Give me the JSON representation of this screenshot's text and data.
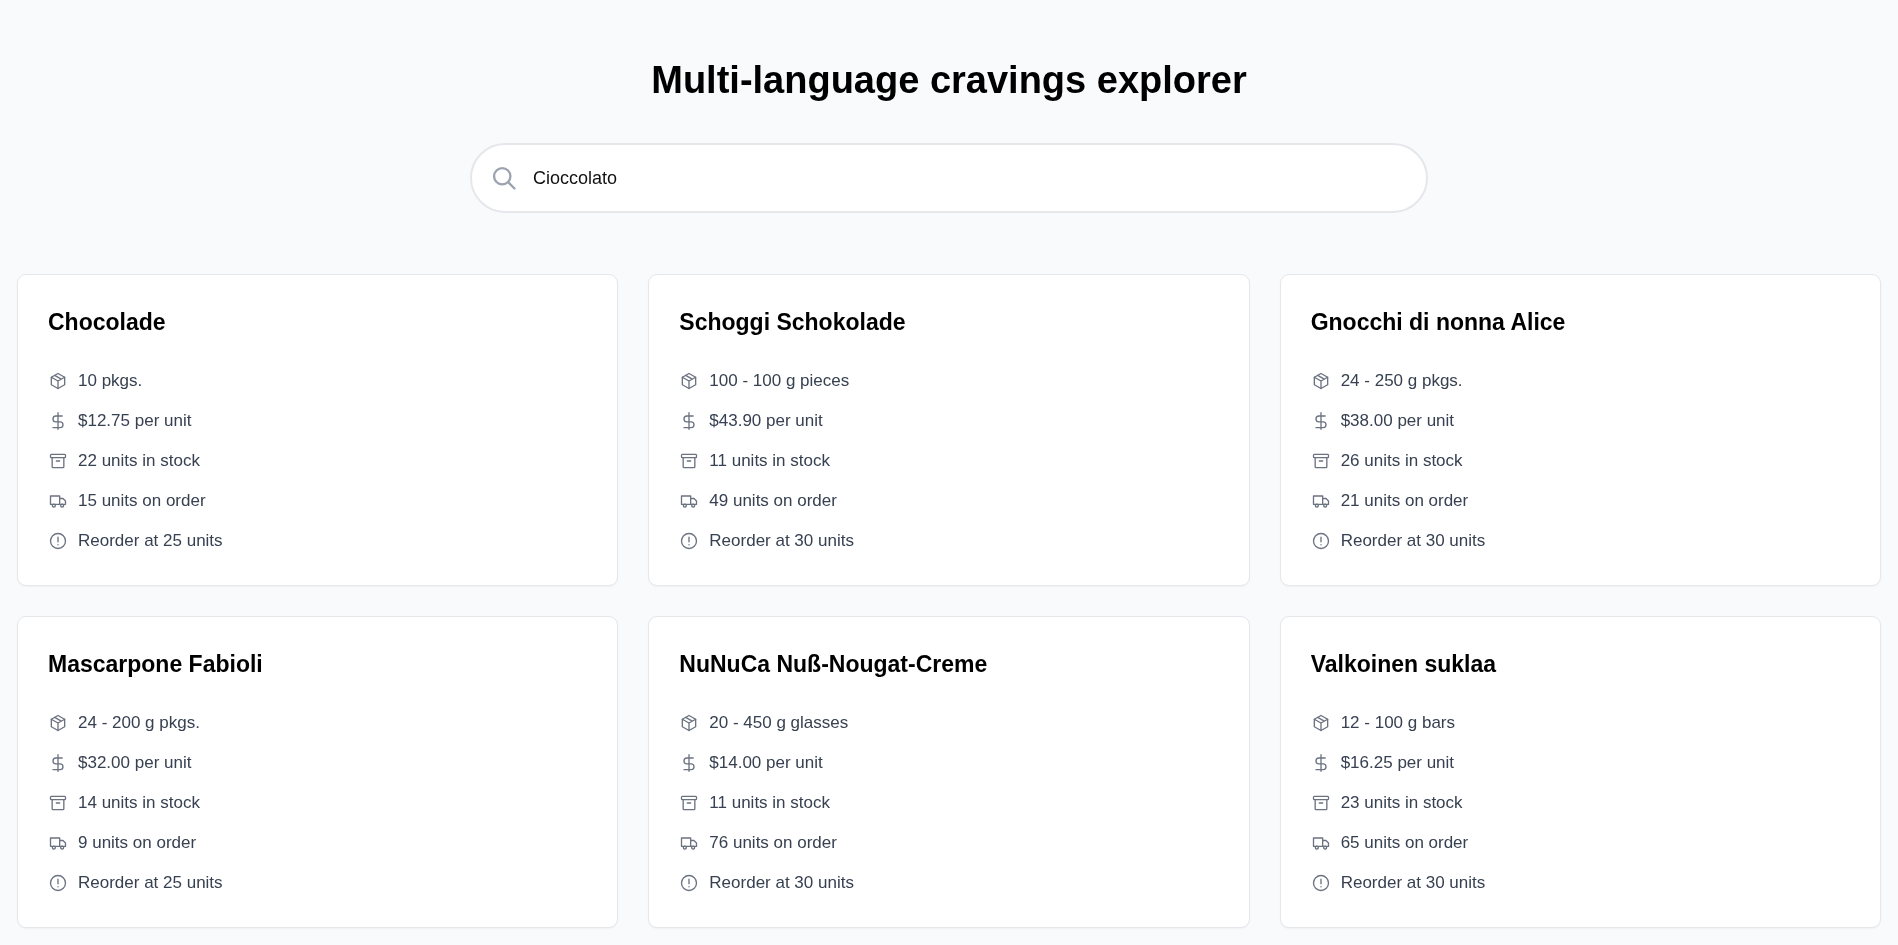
{
  "title": "Multi-language cravings explorer",
  "search": {
    "value": "Cioccolato"
  },
  "products": [
    {
      "name": "Chocolade",
      "details": [
        {
          "kind": "package",
          "text": "10 pkgs."
        },
        {
          "kind": "price",
          "text": "$12.75 per unit"
        },
        {
          "kind": "stock",
          "text": "22 units in stock"
        },
        {
          "kind": "order",
          "text": "15 units on order"
        },
        {
          "kind": "reorder",
          "text": "Reorder at 25 units"
        }
      ]
    },
    {
      "name": "Schoggi Schokolade",
      "details": [
        {
          "kind": "package",
          "text": "100 - 100 g pieces"
        },
        {
          "kind": "price",
          "text": "$43.90 per unit"
        },
        {
          "kind": "stock",
          "text": "11 units in stock"
        },
        {
          "kind": "order",
          "text": "49 units on order"
        },
        {
          "kind": "reorder",
          "text": "Reorder at 30 units"
        }
      ]
    },
    {
      "name": "Gnocchi di nonna Alice",
      "details": [
        {
          "kind": "package",
          "text": "24 - 250 g pkgs."
        },
        {
          "kind": "price",
          "text": "$38.00 per unit"
        },
        {
          "kind": "stock",
          "text": "26 units in stock"
        },
        {
          "kind": "order",
          "text": "21 units on order"
        },
        {
          "kind": "reorder",
          "text": "Reorder at 30 units"
        }
      ]
    },
    {
      "name": "Mascarpone Fabioli",
      "details": [
        {
          "kind": "package",
          "text": "24 - 200 g pkgs."
        },
        {
          "kind": "price",
          "text": "$32.00 per unit"
        },
        {
          "kind": "stock",
          "text": "14 units in stock"
        },
        {
          "kind": "order",
          "text": "9 units on order"
        },
        {
          "kind": "reorder",
          "text": "Reorder at 25 units"
        }
      ]
    },
    {
      "name": "NuNuCa Nuß-Nougat-Creme",
      "details": [
        {
          "kind": "package",
          "text": "20 - 450 g glasses"
        },
        {
          "kind": "price",
          "text": "$14.00 per unit"
        },
        {
          "kind": "stock",
          "text": "11 units in stock"
        },
        {
          "kind": "order",
          "text": "76 units on order"
        },
        {
          "kind": "reorder",
          "text": "Reorder at 30 units"
        }
      ]
    },
    {
      "name": "Valkoinen suklaa",
      "details": [
        {
          "kind": "package",
          "text": "12 - 100 g bars"
        },
        {
          "kind": "price",
          "text": "$16.25 per unit"
        },
        {
          "kind": "stock",
          "text": "23 units in stock"
        },
        {
          "kind": "order",
          "text": "65 units on order"
        },
        {
          "kind": "reorder",
          "text": "Reorder at 30 units"
        }
      ]
    }
  ]
}
